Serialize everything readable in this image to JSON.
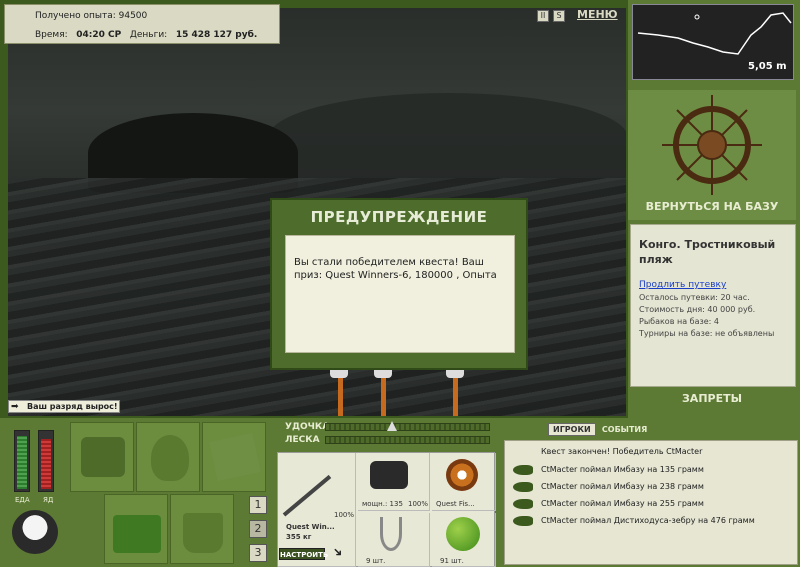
{
  "status": {
    "experience_label": "Получено опыта:",
    "experience_value": "94500",
    "time_label": "Время:",
    "time_value": "04:20 СР",
    "money_label": "Деньги:",
    "money_value": "15 428 127 руб."
  },
  "topbar": {
    "pause_glyph": "II",
    "sound_glyph": "S",
    "menu_label": "МЕНЮ"
  },
  "minimap": {
    "depth": "5,05 m"
  },
  "location": {
    "return_label": "ВЕРНУТЬСЯ НА БАЗУ",
    "title": "Конго. Тростниковый пляж",
    "extend_link": "Продлить путевку",
    "remaining": "Осталось путевки: 20 час.",
    "day_cost": "Стоимость дня: 40 000 руб.",
    "fishers": "Рыбаков на базе: 4",
    "tournaments": "Турниры на базе: не объявлены",
    "bans_label": "ЗАПРЕТЫ"
  },
  "dialog": {
    "title": "ПРЕДУПРЕЖДЕНИЕ",
    "message": "Вы стали победителем квеста! Ваш приз: Quest Winners-6, 180000 , Опыта"
  },
  "rank_badge": "Ваш разряд вырос!",
  "meters": {
    "food_label": "ЕДА",
    "poison_label": "ЯД",
    "food_level": 0.95,
    "poison_level": 0.9
  },
  "inventory_tabs": [
    "1",
    "2",
    "3"
  ],
  "rod": {
    "rod_label": "УДОЧКА",
    "line_label": "ЛЕСКА",
    "rod_name": "Quest Win...",
    "rod_weight": "355 кг",
    "rod_percent": "100%",
    "reel_info": "мощн.: 135",
    "reel_percent": "100%",
    "line_name": "Quest Fis...",
    "hooks_count": "9 шт.",
    "bait_count": "91 шт.",
    "setup_label": "НАСТРОИТЬ"
  },
  "events": {
    "tab_players": "ИГРОКИ",
    "tab_events": "СОБЫТИЯ",
    "lines": [
      "Квест закончен! Победитель CtMacter",
      "CtMacter поймал Имбазу на 135 грамм",
      "CtMacter поймал Имбазу на 238 грамм",
      "CtMacter поймал Имбазу на 255 грамм",
      "CtMacter поймал Дистиходуса-зебру на 476 грамм"
    ]
  },
  "colors": {
    "panel_green": "#5c7a34",
    "dialog_green": "#4e6d2c",
    "cream": "#f1f0de"
  }
}
